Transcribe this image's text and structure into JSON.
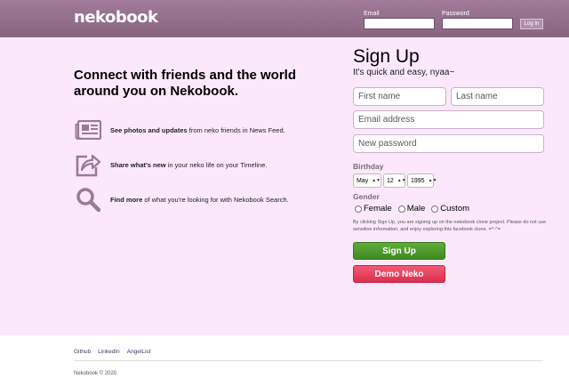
{
  "header": {
    "logo": "nekobook",
    "email_label": "Email",
    "password_label": "Password",
    "login_label": "Log In"
  },
  "intro": {
    "headline": "Connect with friends and the world around you on Nekobook.",
    "features": [
      {
        "icon": "newspaper-icon",
        "bold": "See photos and updates",
        "rest": " from neko friends in News Feed."
      },
      {
        "icon": "share-icon",
        "bold": "Share what's new",
        "rest": " in your neko life on your Timeline."
      },
      {
        "icon": "search-icon",
        "bold": "Find more",
        "rest": " of what you're looking for with Nekobook Search."
      }
    ]
  },
  "signup": {
    "title": "Sign Up",
    "subtitle": "It's quick and easy, nyaa~",
    "first_name_placeholder": "First name",
    "last_name_placeholder": "Last name",
    "email_placeholder": "Email address",
    "password_placeholder": "New password",
    "birthday_label": "Birthday",
    "birthday": {
      "month": "May",
      "day": "12",
      "year": "1995"
    },
    "gender_label": "Gender",
    "genders": [
      "Female",
      "Male",
      "Custom"
    ],
    "disclaimer": "By clicking Sign Up, you are signing up on the nekobook clone project. Please do not use sensitive information, and enjoy exploring this facebook clone. =^-^=",
    "signup_button": "Sign Up",
    "demo_button": "Demo Neko"
  },
  "footer": {
    "links": [
      "Github",
      "LinkedIn",
      "AngelList"
    ],
    "copyright": "Nekobook © 2020"
  },
  "colors": {
    "header": "#8a6581",
    "background": "#fbe9fb",
    "icon": "#9b7a95",
    "signup_green": "#4a9a2b",
    "demo_red": "#e2405e"
  }
}
